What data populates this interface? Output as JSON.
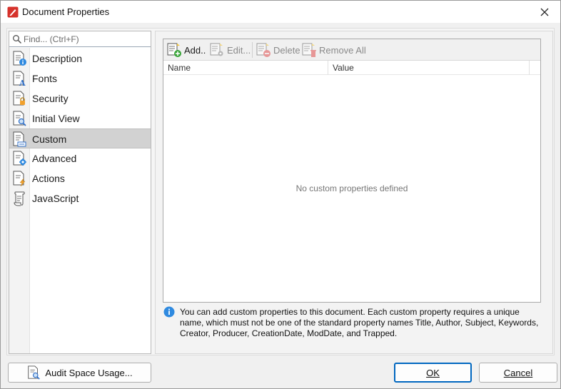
{
  "window": {
    "title": "Document Properties",
    "close_icon": "close-icon",
    "app_icon": "pdf-app-icon"
  },
  "search": {
    "placeholder": "Find... (Ctrl+F)",
    "value": ""
  },
  "sidebar": {
    "items": [
      {
        "label": "Description",
        "icon": "document-info-icon",
        "selected": false
      },
      {
        "label": "Fonts",
        "icon": "document-font-icon",
        "selected": false
      },
      {
        "label": "Security",
        "icon": "document-lock-icon",
        "selected": false
      },
      {
        "label": "Initial View",
        "icon": "document-magnifier-icon",
        "selected": false
      },
      {
        "label": "Custom",
        "icon": "document-custom-icon",
        "selected": true
      },
      {
        "label": "Advanced",
        "icon": "document-gear-icon",
        "selected": false
      },
      {
        "label": "Actions",
        "icon": "document-lightning-icon",
        "selected": false
      },
      {
        "label": "JavaScript",
        "icon": "script-scroll-icon",
        "selected": false
      }
    ]
  },
  "toolbar": {
    "add_label": "Add..",
    "edit_label": "Edit...",
    "delete_label": "Delete",
    "remove_all_label": "Remove All"
  },
  "table": {
    "columns": [
      "Name",
      "Value"
    ],
    "rows": [],
    "empty_message": "No custom properties defined"
  },
  "info": {
    "text": "You can add custom properties to this document. Each custom property requires a unique name, which must not be one of the standard property names Title, Author, Subject, Keywords, Creator, Producer, CreationDate, ModDate, and Trapped."
  },
  "footer": {
    "audit_label": "Audit Space Usage...",
    "ok_label": "OK",
    "cancel_label": "Cancel"
  },
  "colors": {
    "accent": "#0067c0",
    "selected_row": "#d2d2d2",
    "info_blue": "#2f8ae0",
    "icon_orange": "#f2a12c"
  }
}
